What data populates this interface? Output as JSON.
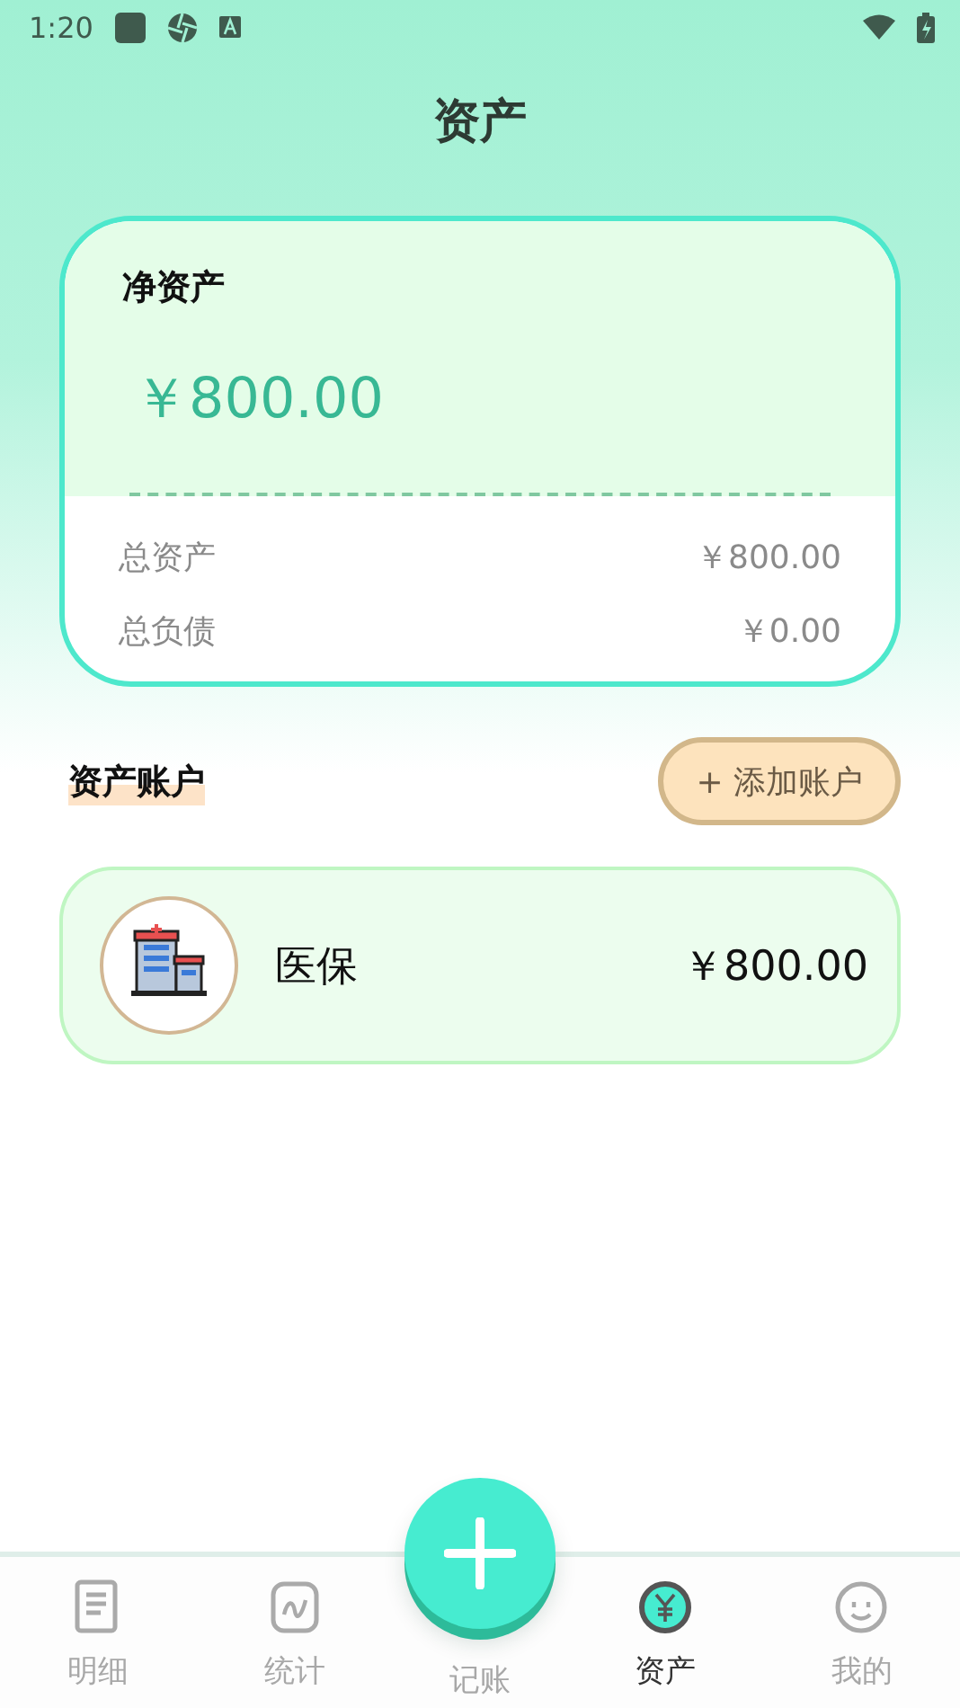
{
  "status_bar": {
    "time": "1:20"
  },
  "header": {
    "title": "资产"
  },
  "summary": {
    "net_label": "净资产",
    "net_value": "￥800.00",
    "rows": [
      {
        "label": "总资产",
        "value": "￥800.00"
      },
      {
        "label": "总负债",
        "value": "￥0.00"
      }
    ]
  },
  "accounts": {
    "title": "资产账户",
    "add_button": "+ 添加账户",
    "items": [
      {
        "name": "医保",
        "amount": "￥800.00"
      }
    ]
  },
  "tab_bar": [
    {
      "label": "明细",
      "kind": "list",
      "selected": false
    },
    {
      "label": "统计",
      "kind": "chart",
      "selected": false
    },
    {
      "label": "记账",
      "kind": "add",
      "selected": false
    },
    {
      "label": "资产",
      "kind": "asset",
      "selected": true
    },
    {
      "label": "我的",
      "kind": "user",
      "selected": false
    }
  ]
}
